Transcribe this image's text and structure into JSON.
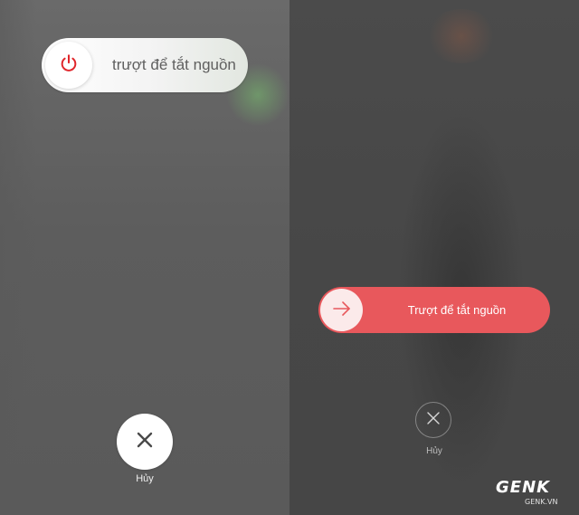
{
  "ios_screen": {
    "slider": {
      "label": "trượt để tắt nguồn",
      "knob_icon": "power-icon",
      "icon_color": "#e0262b"
    },
    "cancel": {
      "icon": "close-icon",
      "label": "Hủy"
    }
  },
  "android_screen": {
    "slider": {
      "label": "Trượt để tắt nguồn",
      "knob_icon": "arrow-right-icon",
      "accent_color": "#e8585c"
    },
    "cancel": {
      "icon": "close-icon",
      "label": "Hủy"
    }
  },
  "watermark": {
    "logo": "GENK",
    "site": "GENK.VN"
  }
}
